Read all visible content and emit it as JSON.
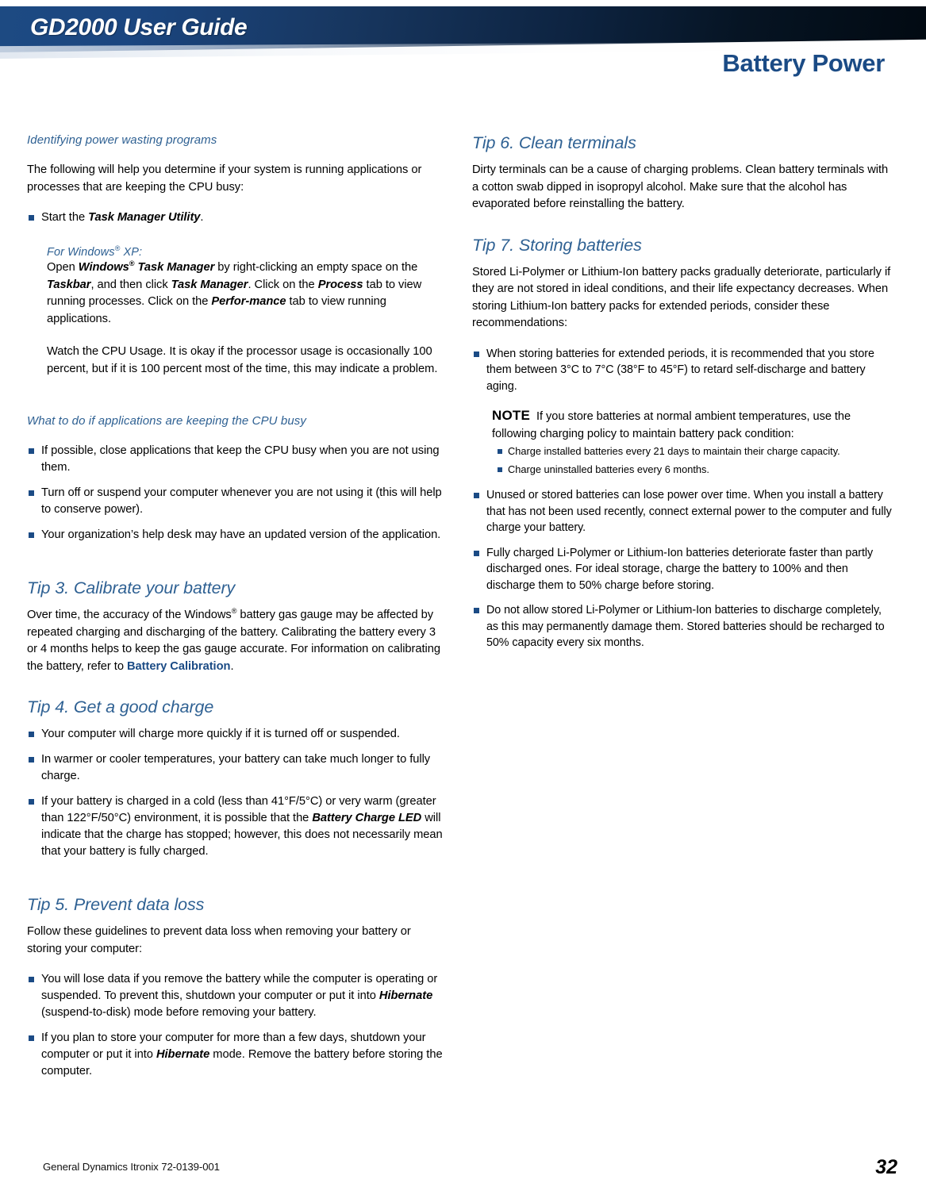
{
  "header": {
    "guide_title": "GD2000 User Guide",
    "chapter_title": "Battery Power",
    "banner_gradient_start": "#1d4a82",
    "banner_gradient_end": "#020a12",
    "accent_blue": "#1b4b85",
    "heading_blue": "#2f6193"
  },
  "footer": {
    "document_id": "General Dynamics Itronix 72-0139-001",
    "page_number": "32"
  },
  "left_column": {
    "section1": {
      "heading": "Identifying power wasting programs",
      "intro": "The following will help you determine if your system is running applications or processes that are keeping the CPU busy:",
      "bullet1_pre": "Start the ",
      "bullet1_bold": "Task Manager Utility",
      "bullet1_post": ".",
      "xp_heading_pre": "For Windows",
      "xp_heading_post": " XP:",
      "xp_para": {
        "t1": "Open ",
        "b1": "Windows",
        "b1_sup": "®",
        "b2": " Task Manager",
        "t2": " by right-clicking an empty space on the ",
        "b3": "Taskbar",
        "t3": ", and then click ",
        "b4": "Task Manager",
        "t4": ".  Click on the ",
        "b5": "Process",
        "t5": " tab to view running processes.  Click on the ",
        "b6": "Perfor-mance",
        "t6": " tab to view running applications."
      },
      "cpu_usage_para": "Watch the CPU Usage. It is okay if the processor usage is occasionally 100 percent, but if it is 100 percent most of the time, this may indicate a problem."
    },
    "section2": {
      "heading": "What to do if applications are keeping the CPU busy",
      "bullets": [
        "If possible, close applications that keep the CPU busy when you are not using them.",
        "Turn off or suspend your computer whenever you are not using it (this will help to conserve power).",
        "Your organization’s help desk may have an updated version of the application."
      ]
    },
    "tip3": {
      "heading": "Tip 3. Calibrate your battery",
      "p1": "Over time, the accuracy of the Windows",
      "p1_sup": "®",
      "p2": " battery gas gauge may be affected by repeated charging and discharging of the battery. Calibrating the battery every 3 or 4 months helps to keep the gas gauge accurate. For information on calibrating the battery, refer to ",
      "link": "Battery Calibration",
      "p3": "."
    },
    "tip4": {
      "heading": "Tip 4. Get a good charge",
      "bullets": [
        "Your computer will charge more quickly if it is turned off or suspended.",
        "In warmer or cooler temperatures, your battery can take much longer to fully charge."
      ],
      "bullet3": {
        "t1": "If your battery is charged in a cold (less than 41°F/5°C) or very warm (greater than 122°F/50°C) environment, it is possible that the ",
        "b1": "Battery Charge LED",
        "t2": " will indicate that the charge has stopped; however, this does not necessarily mean that your battery is fully charged."
      }
    },
    "tip5": {
      "heading": "Tip 5. Prevent data loss",
      "intro": "Follow these guidelines to prevent data loss when removing your battery or storing your computer:",
      "bullet1": {
        "t1": "You will lose data if you remove the battery while the computer is operating or suspended. To prevent this, shutdown your computer or put it into ",
        "b1": "Hibernate",
        "t2": " (suspend-to-disk) mode before removing your battery."
      },
      "bullet2": {
        "t1": "If you plan to store your computer for more than a few days, shutdown your computer or put it into ",
        "b1": "Hibernate",
        "t2": " mode. Remove the battery before storing the computer."
      }
    }
  },
  "right_column": {
    "tip6": {
      "heading": "Tip 6. Clean terminals",
      "body": "Dirty terminals can be a cause of charging problems. Clean battery terminals with a cotton swab dipped in isopropyl alcohol. Make sure that the alcohol has evaporated before reinstalling the battery."
    },
    "tip7": {
      "heading": "Tip 7. Storing batteries",
      "body": "Stored Li-Polymer or Lithium-Ion battery packs gradually deteriorate, particularly if they are not stored in ideal conditions, and their life expectancy decreases.  When storing Lithium-Ion battery packs for extended periods, consider these recommendations:",
      "bullet1": "When storing batteries for extended periods, it is recommended that you store them between 3°C to 7°C (38°F to 45°F) to retard self-discharge and battery aging.",
      "note": {
        "label": "NOTE",
        "text": "If you store batteries at normal ambient temperatures, use the following charging policy to maintain battery pack condition:",
        "subbullets": [
          "Charge installed batteries every 21 days to maintain their charge capacity.",
          "Charge uninstalled batteries every 6 months."
        ]
      },
      "bullet2": "Unused or stored batteries can lose power over time. When you install a battery that has not been used recently, connect external power to the computer and fully charge your battery.",
      "bullet3": "Fully charged Li-Polymer or Lithium-Ion batteries deteriorate faster than partly discharged ones. For ideal storage, charge the battery to 100% and then discharge them to 50% charge before storing.",
      "bullet4": "Do not allow stored Li-Polymer or Lithium-Ion batteries to discharge completely, as this may permanently damage them. Stored batteries should be recharged to 50% capacity every six months."
    }
  }
}
